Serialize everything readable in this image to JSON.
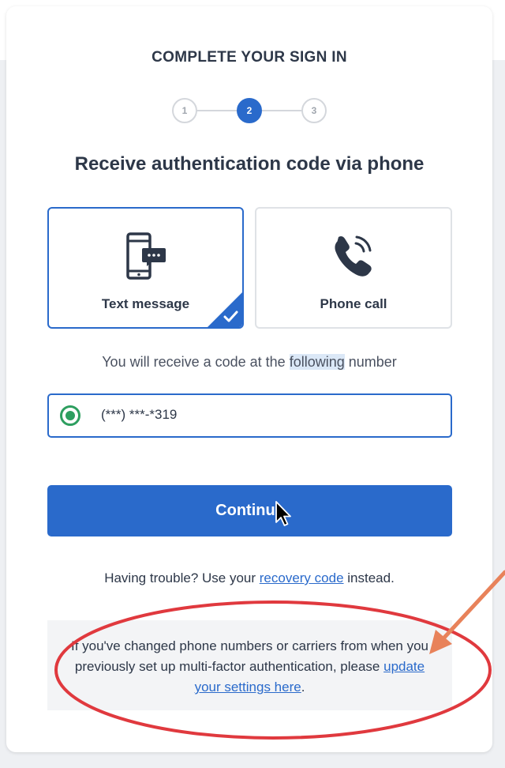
{
  "header": {
    "title": "COMPLETE YOUR SIGN IN"
  },
  "stepper": {
    "steps": [
      "1",
      "2",
      "3"
    ],
    "active_step": 2
  },
  "subheading": "Receive authentication code via phone",
  "options": {
    "text_message": {
      "label": "Text message",
      "icon": "mobile-chat-icon",
      "selected": true
    },
    "phone_call": {
      "label": "Phone call",
      "icon": "phone-ringing-icon",
      "selected": false
    }
  },
  "info": {
    "before": "You will receive a code at the ",
    "highlight": "following",
    "after": " number"
  },
  "phone": {
    "number": "(***) ***-*319",
    "selected": true
  },
  "continue_button": {
    "label": "Continue"
  },
  "trouble": {
    "before": "Having trouble? Use your ",
    "link": "recovery code",
    "after": " instead."
  },
  "notice": {
    "text": "If you've changed phone numbers or carriers from when you previously set up multi-factor authentication, please ",
    "link": "update your settings here",
    "after": "."
  },
  "colors": {
    "primary": "#2a6acb",
    "radio_green": "#2d9e5f",
    "annotation_red": "#e0393e",
    "annotation_orange": "#e8825a"
  }
}
